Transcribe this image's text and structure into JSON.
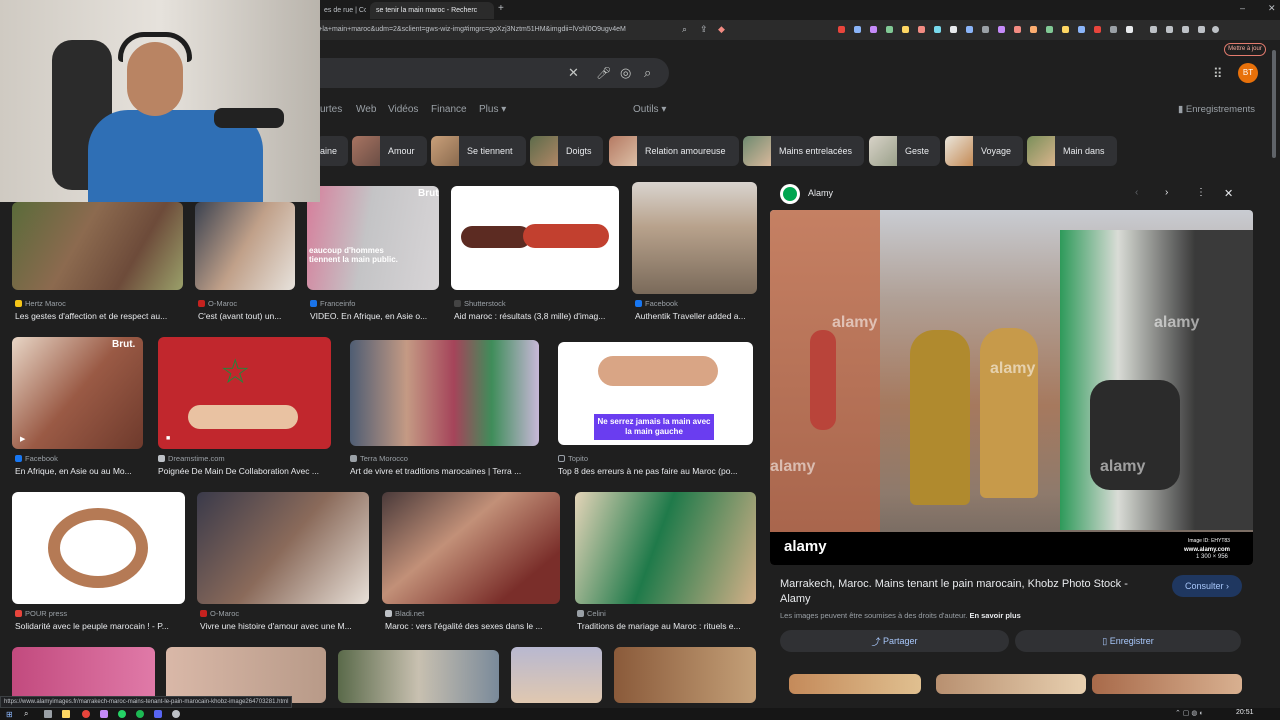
{
  "browser": {
    "tabs": [
      "es de rue | Conc",
      "se tenir la main maroc - Recherc"
    ],
    "url": "r+la+main+maroc&udm=2&sclient=gws-wiz-img#imgrc=goXzj3Nztm51HM&imgdii=lVshl0O9ugv4eM",
    "update_button": "Mettre à jour",
    "status_url": "https://www.alamyimages.fr/marrakech-maroc-mains-tenant-le-pain-marocain-khobz-image264703281.html"
  },
  "google": {
    "nav_tabs": [
      "urtes",
      "Web",
      "Vidéos",
      "Finance",
      "Plus",
      "Outils"
    ],
    "saved_label": "Enregistrements",
    "avatar_initials": "BT",
    "chips": [
      "aine",
      "Amour",
      "Se tiennent",
      "Doigts",
      "Relation amoureuse",
      "Mains entrelacées",
      "Geste",
      "Voyage",
      "Main dans"
    ]
  },
  "results": {
    "row1": [
      {
        "source": "Hertz Maroc",
        "title": "Les gestes d'affection et de respect au..."
      },
      {
        "source": "O-Maroc",
        "title": "C'est (avant tout) un..."
      },
      {
        "source": "Franceinfo",
        "title": "VIDEO. En Afrique, en Asie o..."
      },
      {
        "source": "Shutterstock",
        "title": "Aid maroc : résultats (3,8 mille) d'imag..."
      },
      {
        "source": "Facebook",
        "title": "Authentik Traveller added a..."
      }
    ],
    "row2": [
      {
        "source": "Facebook",
        "title": "En Afrique, en Asie ou au Mo..."
      },
      {
        "source": "Dreamstime.com",
        "title": "Poignée De Main De Collaboration Avec ..."
      },
      {
        "source": "Terra Morocco",
        "title": "Art de vivre et traditions marocaines | Terra ..."
      },
      {
        "source": "Topito",
        "title": "Top 8 des erreurs à ne pas faire au Maroc (po..."
      }
    ],
    "row3": [
      {
        "source": "POUR press",
        "title": "Solidarité avec le peuple marocain ! - P..."
      },
      {
        "source": "O-Maroc",
        "title": "Vivre une histoire d'amour avec une M..."
      },
      {
        "source": "Bladi.net",
        "title": "Maroc : vers l'égalité des sexes dans le ..."
      },
      {
        "source": "Celini",
        "title": "Traditions de mariage au Maroc : rituels e..."
      }
    ],
    "overlay_text": {
      "brut": "Brut.",
      "franceinfo_overlay": "eaucoup d'hommes tiennent la main public.",
      "topito_overlay": "Ne serrez jamais la main avec la main gauche"
    }
  },
  "panel": {
    "source": "Alamy",
    "title": "Marrakech, Maroc. Mains tenant le pain marocain, Khobz Photo Stock - Alamy",
    "rights_note": "Les images peuvent être soumises à des droits d'auteur.",
    "learn_more": "En savoir plus",
    "visit_button": "Consulter",
    "share_button": "Partager",
    "save_button": "Enregistrer",
    "watermark": "alamy",
    "image_id": "Image ID: EHYT83",
    "site": "www.alamy.com",
    "dimensions": "1 300 × 956"
  },
  "taskbar": {
    "time": "20:51"
  }
}
